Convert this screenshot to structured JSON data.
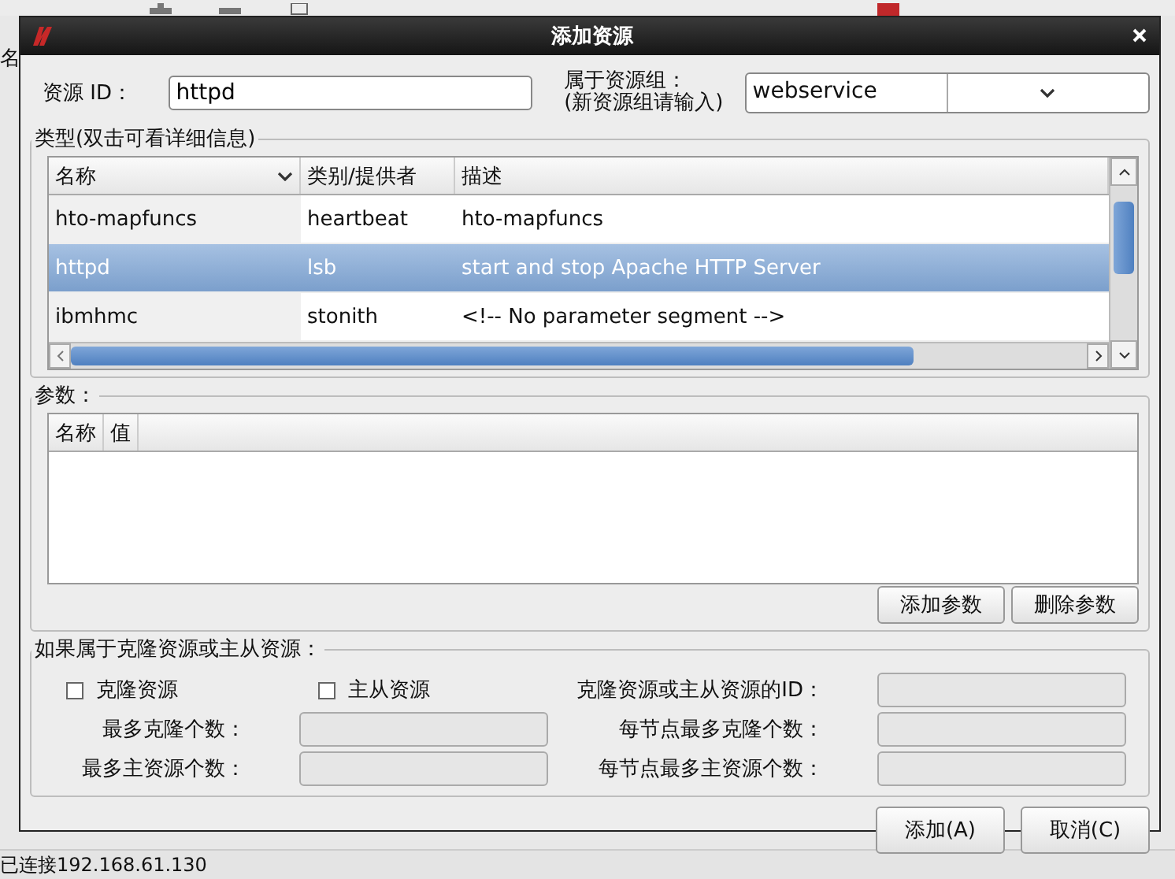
{
  "background": {
    "left_label": "名",
    "status": "已连接192.168.61.130"
  },
  "window": {
    "title": "添加资源"
  },
  "resource_id": {
    "label": "资源 ID：",
    "value": "httpd"
  },
  "group": {
    "label": "属于资源组：",
    "hint": "(新资源组请输入)",
    "value": "webservice"
  },
  "types": {
    "title": "类型(双击可看详细信息)",
    "columns": [
      "名称",
      "类别/提供者",
      "描述"
    ],
    "rows": [
      {
        "name": "hto-mapfuncs",
        "provider": "heartbeat",
        "description": "hto-mapfuncs",
        "selected": false
      },
      {
        "name": "httpd",
        "provider": "lsb",
        "description": "start and stop Apache HTTP Server",
        "selected": true
      },
      {
        "name": "ibmhmc",
        "provider": "stonith",
        "description": "<!-- No parameter segment -->",
        "selected": false
      }
    ]
  },
  "params": {
    "title": "参数：",
    "columns": [
      "名称",
      "值"
    ],
    "buttons": [
      "添加参数",
      "删除参数"
    ]
  },
  "clone": {
    "title": "如果属于克隆资源或主从资源：",
    "checkboxes": [
      {
        "label": "克隆资源",
        "checked": false
      },
      {
        "label": "主从资源",
        "checked": false
      }
    ],
    "fields": [
      {
        "label": "克隆资源或主从资源的ID：",
        "disabled": true
      },
      {
        "label": "最多克隆个数：",
        "disabled": true
      },
      {
        "label": "每节点最多克隆个数：",
        "disabled": true
      },
      {
        "label": "最多主资源个数：",
        "disabled": true
      },
      {
        "label": "每节点最多主资源个数：",
        "disabled": true
      }
    ]
  },
  "buttons": [
    "添加(A)",
    "取消(C)"
  ]
}
